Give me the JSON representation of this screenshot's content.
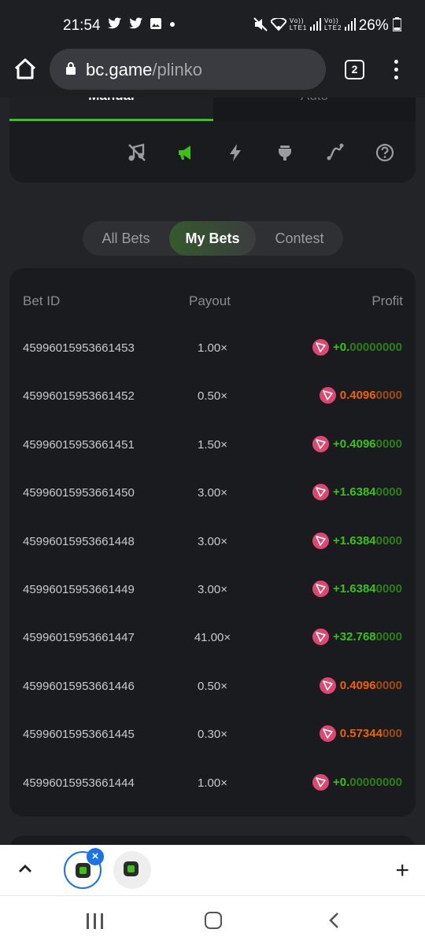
{
  "status_bar": {
    "time": "21:54",
    "left_icons": [
      "twitter-icon",
      "twitter-icon",
      "image-icon",
      "dot-icon"
    ],
    "net_label_1": "Vo)) LTE1",
    "net_label_2": "Vo)) LTE2",
    "battery": "26%"
  },
  "browser": {
    "url_domain": "bc.game",
    "url_path": "/plinko",
    "tab_count": "2"
  },
  "game": {
    "tabs": [
      "Manual",
      "Auto"
    ],
    "active_tab": "Manual",
    "tools": [
      "music-off-icon",
      "sound-icon",
      "hotkey-icon",
      "fairness-icon",
      "live-stats-icon",
      "help-icon"
    ],
    "accent_color": "#3bc117"
  },
  "bet_tabs": {
    "all": "All Bets",
    "my": "My Bets",
    "contest": "Contest",
    "selected": "My Bets"
  },
  "bets_table": {
    "headers": {
      "id": "Bet ID",
      "payout": "Payout",
      "profit": "Profit"
    },
    "rows": [
      {
        "id": "45996015953661453",
        "payout": "1.00×",
        "profit_main": "+0.",
        "profit_tail": "00000000",
        "status": "win"
      },
      {
        "id": "45996015953661452",
        "payout": "0.50×",
        "profit_main": "0.4096",
        "profit_tail": "0000",
        "status": "loss"
      },
      {
        "id": "45996015953661451",
        "payout": "1.50×",
        "profit_main": "+0.4096",
        "profit_tail": "0000",
        "status": "win"
      },
      {
        "id": "45996015953661450",
        "payout": "3.00×",
        "profit_main": "+1.6384",
        "profit_tail": "0000",
        "status": "win"
      },
      {
        "id": "45996015953661448",
        "payout": "3.00×",
        "profit_main": "+1.6384",
        "profit_tail": "0000",
        "status": "win"
      },
      {
        "id": "45996015953661449",
        "payout": "3.00×",
        "profit_main": "+1.6384",
        "profit_tail": "0000",
        "status": "win"
      },
      {
        "id": "45996015953661447",
        "payout": "41.00×",
        "profit_main": "+32.768",
        "profit_tail": "0000",
        "status": "win"
      },
      {
        "id": "45996015953661446",
        "payout": "0.50×",
        "profit_main": "0.4096",
        "profit_tail": "0000",
        "status": "loss"
      },
      {
        "id": "45996015953661445",
        "payout": "0.30×",
        "profit_main": "0.57344",
        "profit_tail": "000",
        "status": "loss"
      },
      {
        "id": "45996015953661444",
        "payout": "1.00×",
        "profit_main": "+0.",
        "profit_tail": "00000000",
        "status": "win"
      }
    ],
    "colors": {
      "win": "#3bc117",
      "win_tail": "#2c7f17",
      "loss": "#ed6300",
      "loss_tail": "#a14a0d",
      "coin": "#e04670"
    }
  },
  "tab_strip": {
    "add_label": "+"
  }
}
